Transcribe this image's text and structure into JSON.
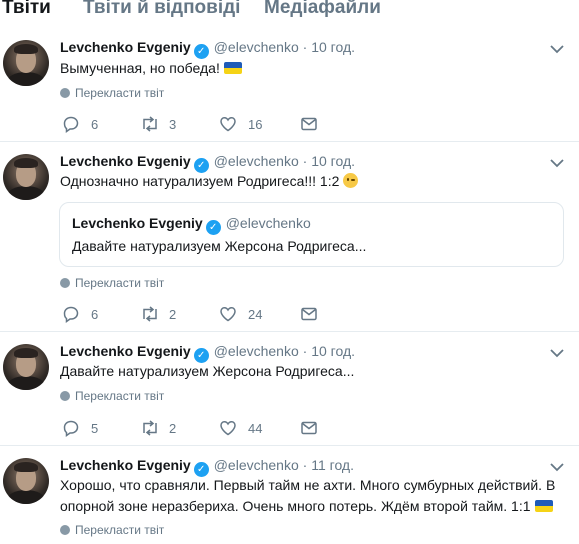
{
  "tabs": [
    "Твіти",
    "Твіти й відповіді",
    "Медіафайли"
  ],
  "tweets": [
    {
      "name": "Levchenko Evgeniy",
      "handle": "@elevchenko",
      "time": "10 год.",
      "text": "Вымученная, но победа!",
      "emoji": "flag-ua",
      "translate": "Перекласти твіт",
      "replies": "6",
      "retweets": "3",
      "likes": "16"
    },
    {
      "name": "Levchenko Evgeniy",
      "handle": "@elevchenko",
      "time": "10 год.",
      "text": "Однозначно натурализуем Родригеса!!! 1:2",
      "emoji": "wink",
      "quote": {
        "name": "Levchenko Evgeniy",
        "handle": "@elevchenko",
        "text": "Давайте натурализуем Жерсона Родригеса..."
      },
      "translate": "Перекласти твіт",
      "replies": "6",
      "retweets": "2",
      "likes": "24"
    },
    {
      "name": "Levchenko Evgeniy",
      "handle": "@elevchenko",
      "time": "10 год.",
      "text": "Давайте натурализуем Жерсона Родригеса...",
      "translate": "Перекласти твіт",
      "replies": "5",
      "retweets": "2",
      "likes": "44"
    },
    {
      "name": "Levchenko Evgeniy",
      "handle": "@elevchenko",
      "time": "11 год.",
      "text": "Хорошо, что сравняли. Первый тайм не ахти. Много сумбурных действий. В опорной зоне неразбериха. Очень много потерь. Ждём второй тайм. 1:1",
      "emoji": "flag-ua",
      "translate": "Перекласти твіт"
    }
  ],
  "colors": {
    "accent": "#1da1f2",
    "muted": "#657786",
    "divider": "#e6ecf0"
  }
}
